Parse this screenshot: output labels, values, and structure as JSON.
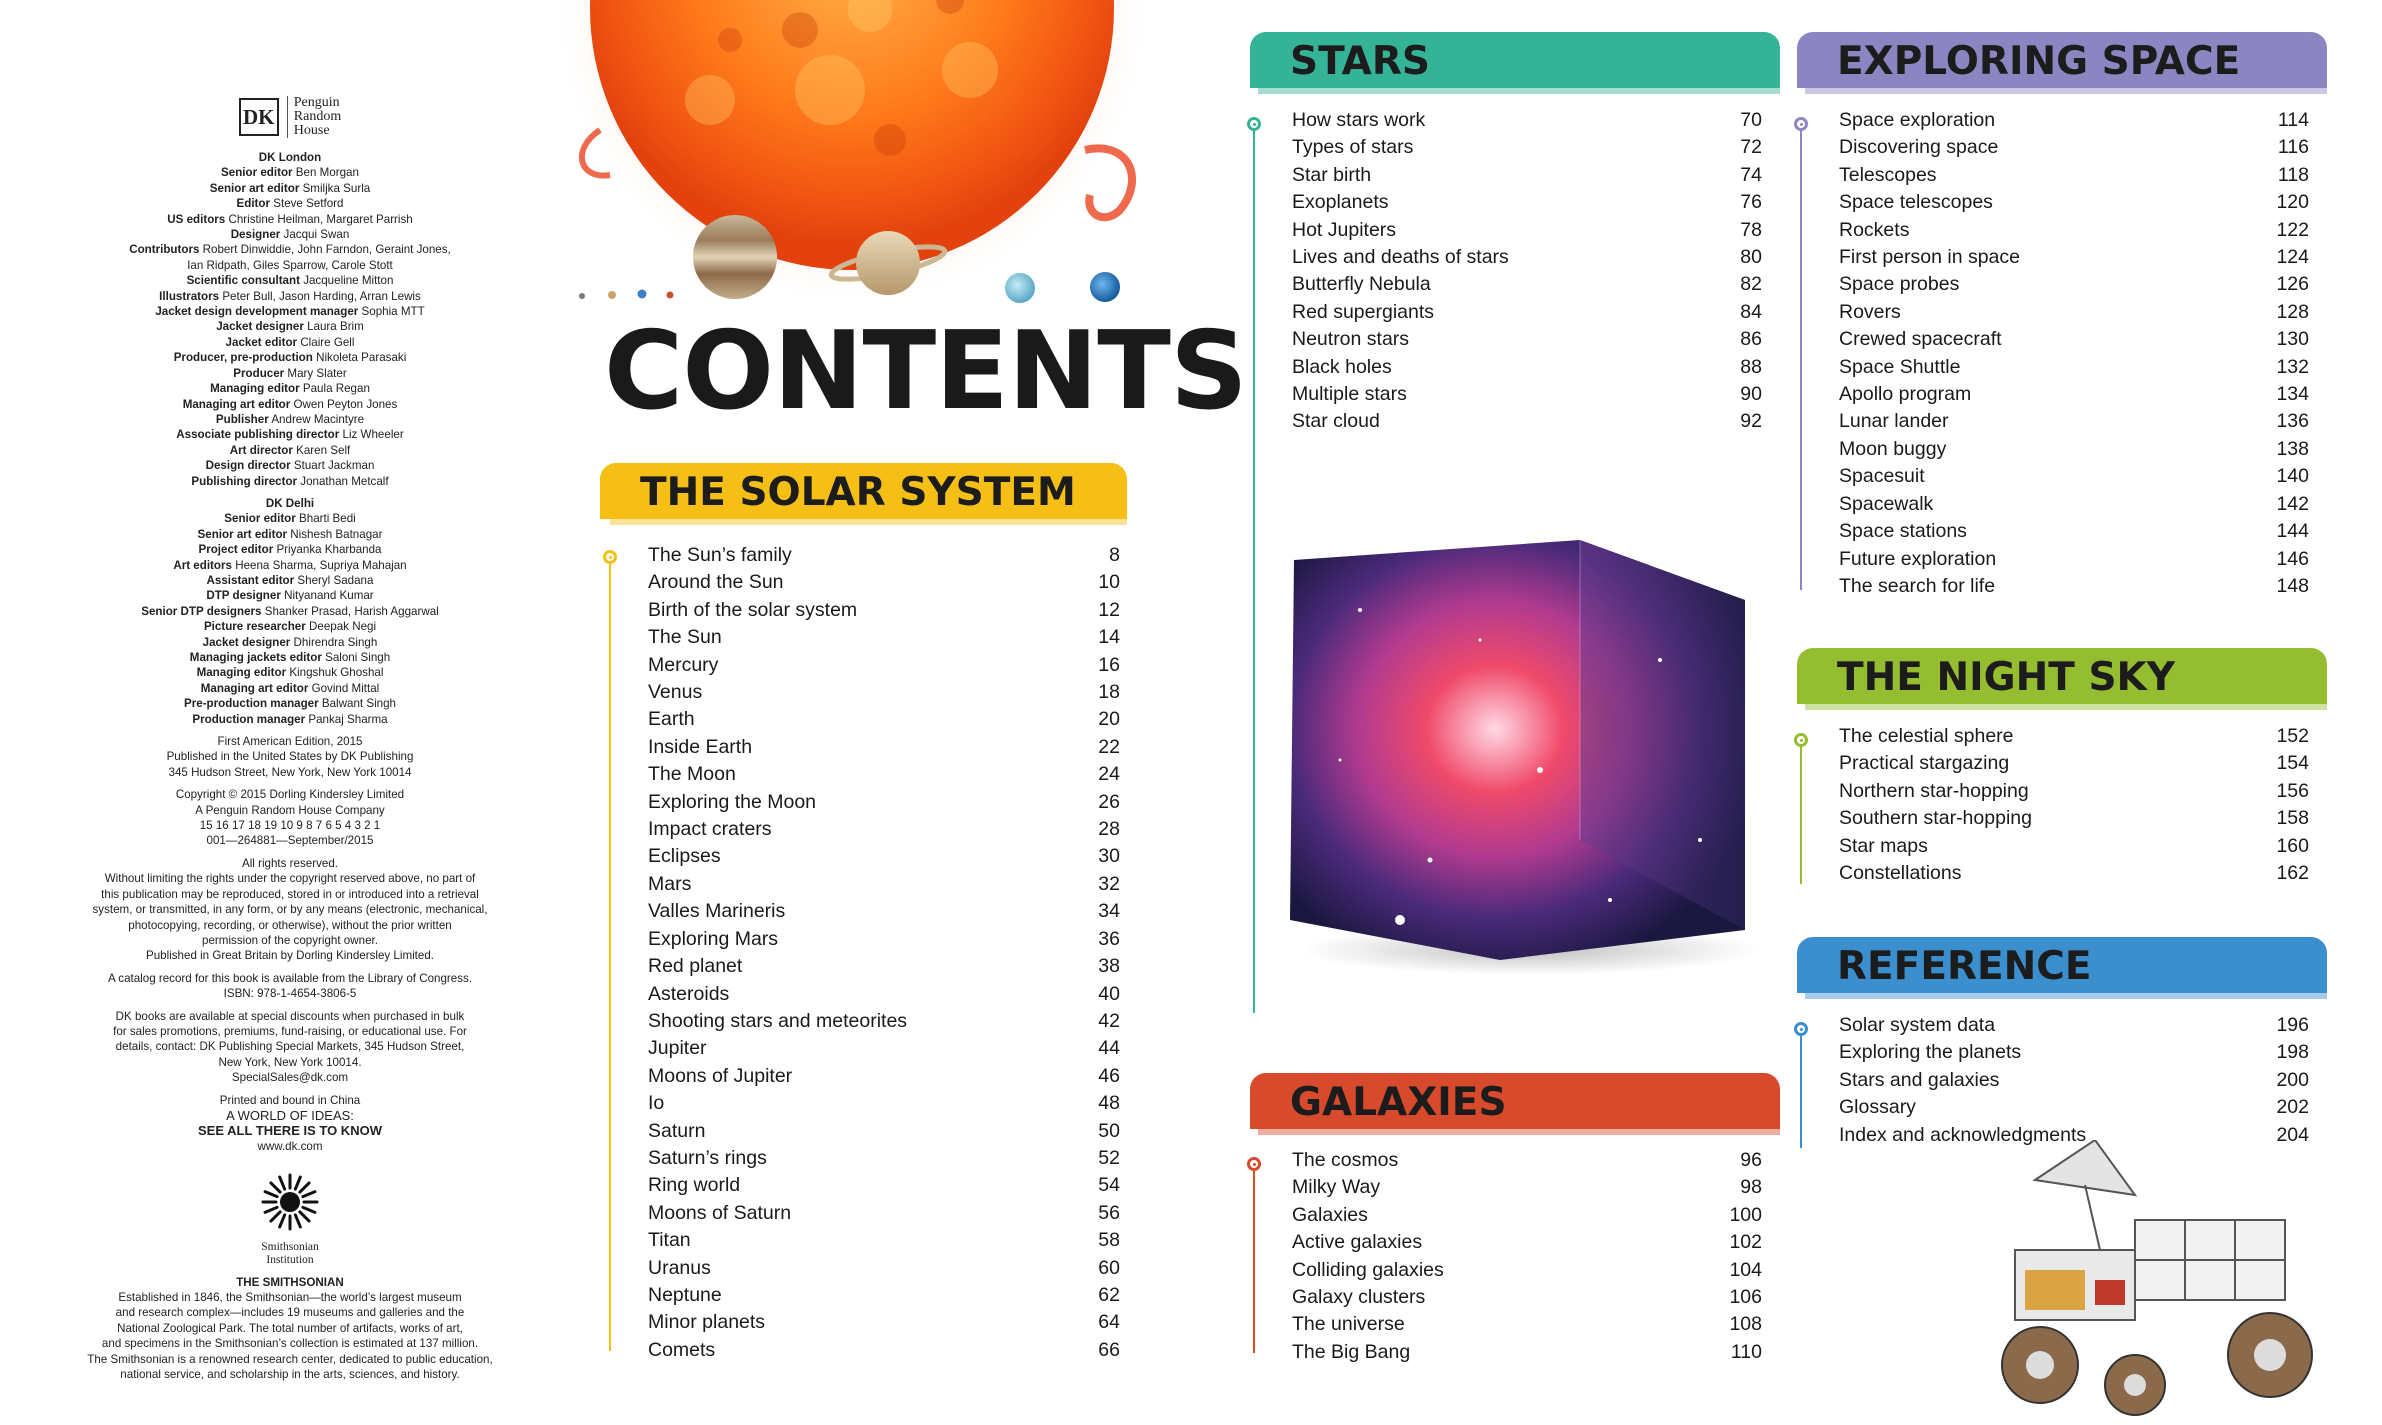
{
  "colors": {
    "solar_system": "#f6bf16",
    "stars": "#35b397",
    "galaxies": "#d84a2c",
    "exploring_space": "#8b86c1",
    "night_sky": "#95bd30",
    "reference": "#3c8fcf"
  },
  "imprint": {
    "logo_dk": "DK",
    "logo_publisher": [
      "Penguin",
      "Random",
      "House"
    ],
    "london_heading": "DK London",
    "london_credits": [
      {
        "role": "Senior editor",
        "name": "Ben Morgan"
      },
      {
        "role": "Senior art editor",
        "name": "Smiljka Surla"
      },
      {
        "role": "Editor",
        "name": "Steve Setford"
      },
      {
        "role": "US editors",
        "name": "Christine Heilman, Margaret Parrish"
      },
      {
        "role": "Designer",
        "name": "Jacqui Swan"
      },
      {
        "role": "Contributors",
        "name": "Robert Dinwiddie, John Farndon, Geraint Jones,"
      },
      {
        "role": "",
        "name": "Ian Ridpath, Giles Sparrow, Carole Stott"
      },
      {
        "role": "Scientific consultant",
        "name": "Jacqueline Mitton"
      },
      {
        "role": "Illustrators",
        "name": "Peter Bull, Jason Harding, Arran Lewis"
      },
      {
        "role": "Jacket design development manager",
        "name": "Sophia MTT"
      },
      {
        "role": "Jacket designer",
        "name": "Laura Brim"
      },
      {
        "role": "Jacket editor",
        "name": "Claire Gell"
      },
      {
        "role": "Producer, pre-production",
        "name": "Nikoleta Parasaki"
      },
      {
        "role": "Producer",
        "name": "Mary Slater"
      },
      {
        "role": "Managing editor",
        "name": "Paula Regan"
      },
      {
        "role": "Managing art editor",
        "name": "Owen Peyton Jones"
      },
      {
        "role": "Publisher",
        "name": "Andrew Macintyre"
      },
      {
        "role": "Associate publishing director",
        "name": "Liz Wheeler"
      },
      {
        "role": "Art director",
        "name": "Karen Self"
      },
      {
        "role": "Design director",
        "name": "Stuart Jackman"
      },
      {
        "role": "Publishing director",
        "name": "Jonathan Metcalf"
      }
    ],
    "delhi_heading": "DK Delhi",
    "delhi_credits": [
      {
        "role": "Senior editor",
        "name": "Bharti Bedi"
      },
      {
        "role": "Senior art editor",
        "name": "Nishesh Batnagar"
      },
      {
        "role": "Project editor",
        "name": "Priyanka Kharbanda"
      },
      {
        "role": "Art editors",
        "name": "Heena Sharma, Supriya Mahajan"
      },
      {
        "role": "Assistant editor",
        "name": "Sheryl Sadana"
      },
      {
        "role": "DTP designer",
        "name": "Nityanand Kumar"
      },
      {
        "role": "Senior DTP designers",
        "name": "Shanker Prasad, Harish Aggarwal"
      },
      {
        "role": "Picture researcher",
        "name": "Deepak Negi"
      },
      {
        "role": "Jacket designer",
        "name": "Dhirendra Singh"
      },
      {
        "role": "Managing jackets editor",
        "name": "Saloni Singh"
      },
      {
        "role": "Managing editor",
        "name": "Kingshuk Ghoshal"
      },
      {
        "role": "Managing art editor",
        "name": "Govind Mittal"
      },
      {
        "role": "Pre-production manager",
        "name": "Balwant Singh"
      },
      {
        "role": "Production manager",
        "name": "Pankaj Sharma"
      }
    ],
    "edition": [
      "First American Edition, 2015",
      "Published in the United States by DK Publishing",
      "345 Hudson Street, New York, New York 10014"
    ],
    "copyright": [
      "Copyright © 2015 Dorling Kindersley Limited",
      "A Penguin Random House Company",
      "15 16 17 18 19  10 9 8 7 6 5 4 3 2 1",
      "001—264881—September/2015"
    ],
    "rights": [
      "All rights reserved.",
      "Without limiting the rights under the copyright reserved above, no part of",
      "this publication may be reproduced, stored in or introduced into a retrieval",
      "system, or transmitted, in any form, or by any means (electronic, mechanical,",
      "photocopying, recording, or otherwise), without the prior written",
      "permission of the copyright owner.",
      "Published in Great Britain by Dorling Kindersley Limited."
    ],
    "catalog": [
      "A catalog record for this book is available from the Library of Congress.",
      "ISBN: 978-1-4654-3806-5"
    ],
    "special_sales": [
      "DK books are available at special discounts when purchased in bulk",
      "for sales promotions, premiums, fund-raising, or educational use. For",
      "details, contact: DK Publishing Special Markets, 345 Hudson Street,",
      "New York, New York 10014.",
      "SpecialSales@dk.com"
    ],
    "printed": "Printed and bound in China",
    "tagline_1": "A WORLD OF IDEAS:",
    "tagline_2": "SEE ALL THERE IS TO KNOW",
    "website": "www.dk.com",
    "smithsonian_logo_text": [
      "Smithsonian",
      "Institution"
    ],
    "smithsonian_heading": "THE SMITHSONIAN",
    "smithsonian_text": [
      "Established in 1846, the Smithsonian—the world’s largest museum",
      "and research complex—includes 19 museums and galleries and the",
      "National Zoological Park. The total number of artifacts, works of art,",
      "and specimens in the Smithsonian’s collection is estimated at 137 million.",
      "The Smithsonian is a renowned research center, dedicated to public education,",
      "national service, and scholarship in the arts, sciences, and history."
    ]
  },
  "contents_title": "CONTENTS",
  "sections": {
    "solar_system": {
      "title": "THE SOLAR SYSTEM",
      "entries": [
        {
          "title": "The Sun’s family",
          "page": "8"
        },
        {
          "title": "Around the Sun",
          "page": "10"
        },
        {
          "title": "Birth of the solar system",
          "page": "12"
        },
        {
          "title": "The Sun",
          "page": "14"
        },
        {
          "title": "Mercury",
          "page": "16"
        },
        {
          "title": "Venus",
          "page": "18"
        },
        {
          "title": "Earth",
          "page": "20"
        },
        {
          "title": "Inside Earth",
          "page": "22"
        },
        {
          "title": "The Moon",
          "page": "24"
        },
        {
          "title": "Exploring the Moon",
          "page": "26"
        },
        {
          "title": "Impact craters",
          "page": "28"
        },
        {
          "title": "Eclipses",
          "page": "30"
        },
        {
          "title": "Mars",
          "page": "32"
        },
        {
          "title": "Valles Marineris",
          "page": "34"
        },
        {
          "title": "Exploring Mars",
          "page": "36"
        },
        {
          "title": "Red planet",
          "page": "38"
        },
        {
          "title": "Asteroids",
          "page": "40"
        },
        {
          "title": "Shooting stars and meteorites",
          "page": "42"
        },
        {
          "title": "Jupiter",
          "page": "44"
        },
        {
          "title": "Moons of Jupiter",
          "page": "46"
        },
        {
          "title": "Io",
          "page": "48"
        },
        {
          "title": "Saturn",
          "page": "50"
        },
        {
          "title": "Saturn’s rings",
          "page": "52"
        },
        {
          "title": "Ring world",
          "page": "54"
        },
        {
          "title": "Moons of Saturn",
          "page": "56"
        },
        {
          "title": "Titan",
          "page": "58"
        },
        {
          "title": "Uranus",
          "page": "60"
        },
        {
          "title": "Neptune",
          "page": "62"
        },
        {
          "title": "Minor planets",
          "page": "64"
        },
        {
          "title": "Comets",
          "page": "66"
        }
      ]
    },
    "stars": {
      "title": "STARS",
      "entries": [
        {
          "title": "How stars work",
          "page": "70"
        },
        {
          "title": "Types of stars",
          "page": "72"
        },
        {
          "title": "Star birth",
          "page": "74"
        },
        {
          "title": "Exoplanets",
          "page": "76"
        },
        {
          "title": "Hot Jupiters",
          "page": "78"
        },
        {
          "title": "Lives and deaths of stars",
          "page": "80"
        },
        {
          "title": "Butterfly Nebula",
          "page": "82"
        },
        {
          "title": "Red supergiants",
          "page": "84"
        },
        {
          "title": "Neutron stars",
          "page": "86"
        },
        {
          "title": "Black holes",
          "page": "88"
        },
        {
          "title": "Multiple stars",
          "page": "90"
        },
        {
          "title": "Star cloud",
          "page": "92"
        }
      ]
    },
    "galaxies": {
      "title": "GALAXIES",
      "entries": [
        {
          "title": "The cosmos",
          "page": "96"
        },
        {
          "title": "Milky Way",
          "page": "98"
        },
        {
          "title": "Galaxies",
          "page": "100"
        },
        {
          "title": "Active galaxies",
          "page": "102"
        },
        {
          "title": "Colliding galaxies",
          "page": "104"
        },
        {
          "title": "Galaxy clusters",
          "page": "106"
        },
        {
          "title": "The universe",
          "page": "108"
        },
        {
          "title": "The Big Bang",
          "page": "110"
        }
      ]
    },
    "exploring_space": {
      "title": "EXPLORING SPACE",
      "entries": [
        {
          "title": "Space exploration",
          "page": "114"
        },
        {
          "title": "Discovering space",
          "page": "116"
        },
        {
          "title": "Telescopes",
          "page": "118"
        },
        {
          "title": "Space telescopes",
          "page": "120"
        },
        {
          "title": "Rockets",
          "page": "122"
        },
        {
          "title": "First person in space",
          "page": "124"
        },
        {
          "title": "Space probes",
          "page": "126"
        },
        {
          "title": "Rovers",
          "page": "128"
        },
        {
          "title": "Crewed spacecraft",
          "page": "130"
        },
        {
          "title": "Space Shuttle",
          "page": "132"
        },
        {
          "title": "Apollo program",
          "page": "134"
        },
        {
          "title": "Lunar lander",
          "page": "136"
        },
        {
          "title": "Moon buggy",
          "page": "138"
        },
        {
          "title": "Spacesuit",
          "page": "140"
        },
        {
          "title": "Spacewalk",
          "page": "142"
        },
        {
          "title": "Space stations",
          "page": "144"
        },
        {
          "title": "Future exploration",
          "page": "146"
        },
        {
          "title": "The search for life",
          "page": "148"
        }
      ]
    },
    "night_sky": {
      "title": "THE NIGHT SKY",
      "entries": [
        {
          "title": "The celestial sphere",
          "page": "152"
        },
        {
          "title": "Practical stargazing",
          "page": "154"
        },
        {
          "title": "Northern star-hopping",
          "page": "156"
        },
        {
          "title": "Southern star-hopping",
          "page": "158"
        },
        {
          "title": "Star maps",
          "page": "160"
        },
        {
          "title": "Constellations",
          "page": "162"
        }
      ]
    },
    "reference": {
      "title": "REFERENCE",
      "entries": [
        {
          "title": "Solar system data",
          "page": "196"
        },
        {
          "title": "Exploring the planets",
          "page": "198"
        },
        {
          "title": "Stars and galaxies",
          "page": "200"
        },
        {
          "title": "Glossary",
          "page": "202"
        },
        {
          "title": "Index and acknowledgments",
          "page": "204"
        }
      ]
    }
  }
}
